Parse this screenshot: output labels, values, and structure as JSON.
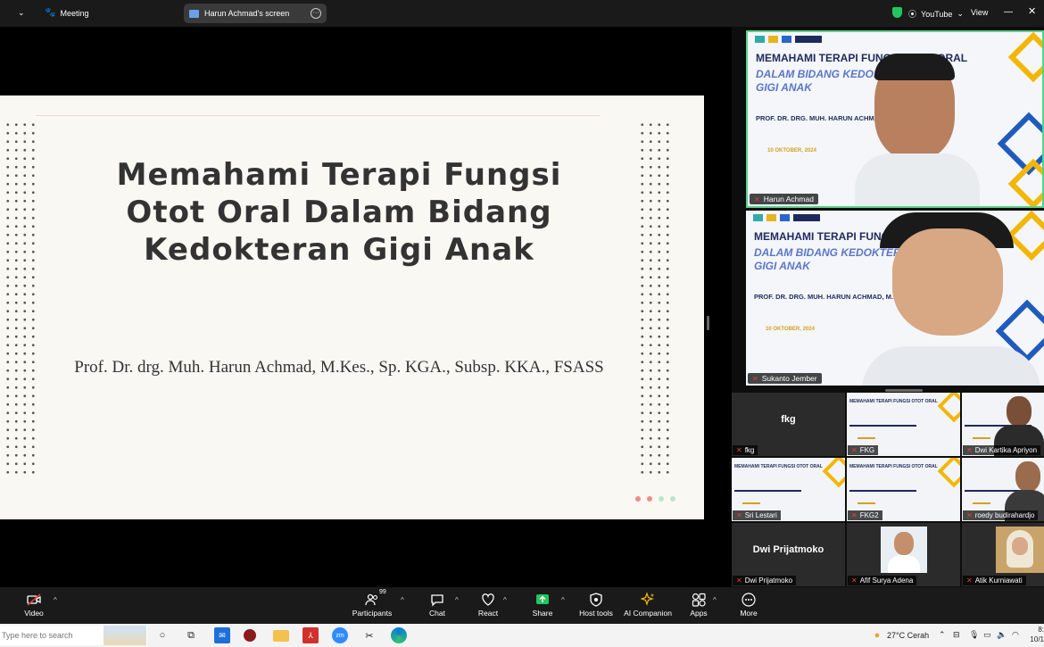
{
  "topbar": {
    "meeting_label": "Meeting",
    "screen_label": "Harun Achmad's screen",
    "youtube_label": "YouTube",
    "view_label": "View"
  },
  "slide": {
    "title_line1": "Memahami Terapi Fungsi",
    "title_line2": "Otot Oral Dalam Bidang",
    "title_line3": "Kedokteran Gigi Anak",
    "author": "Prof. Dr. drg. Muh. Harun Achmad, M.Kes., Sp. KGA., Subsp. KKA., FSASS"
  },
  "mini_slide": {
    "line1": "MEMAHAMI TERAPI FUNGSI OTOT ORAL",
    "line2a": "DALAM BIDANG KEDOKTERAN",
    "line2b": "GIGI ANAK",
    "line3": "PROF. DR. DRG. MUH. HARUN ACHMAD, M.KES",
    "line4": "10 OKTOBER, 2024"
  },
  "speakers": [
    {
      "name": "Harun Achmad"
    },
    {
      "name": "Sukanto Jember"
    }
  ],
  "grid": [
    {
      "name": "fkg",
      "big": "fkg"
    },
    {
      "name": "FKG"
    },
    {
      "name": "Dwi Kartika Apriyon"
    },
    {
      "name": "Sri Lestari"
    },
    {
      "name": "FKG2"
    },
    {
      "name": "roedy budirahardjo"
    },
    {
      "name": "Dwi Prijatmoko",
      "big": "Dwi Prijatmoko"
    },
    {
      "name": "Afif Surya Adena"
    },
    {
      "name": "Atik Kurniawati"
    }
  ],
  "toolbar": {
    "video": "Video",
    "participants": "Participants",
    "participants_count": "99",
    "chat": "Chat",
    "react": "React",
    "share": "Share",
    "host_tools": "Host tools",
    "ai_companion": "AI Companion",
    "apps": "Apps",
    "more": "More"
  },
  "taskbar": {
    "search_placeholder": "Type here to search",
    "weather": "27°C  Cerah",
    "time": "8:",
    "date": "10/1"
  },
  "colors": {
    "accent_green": "#58d089",
    "share_green": "#22c55e",
    "mic_red": "#e0413a",
    "slide_bg": "#faf8f3"
  }
}
